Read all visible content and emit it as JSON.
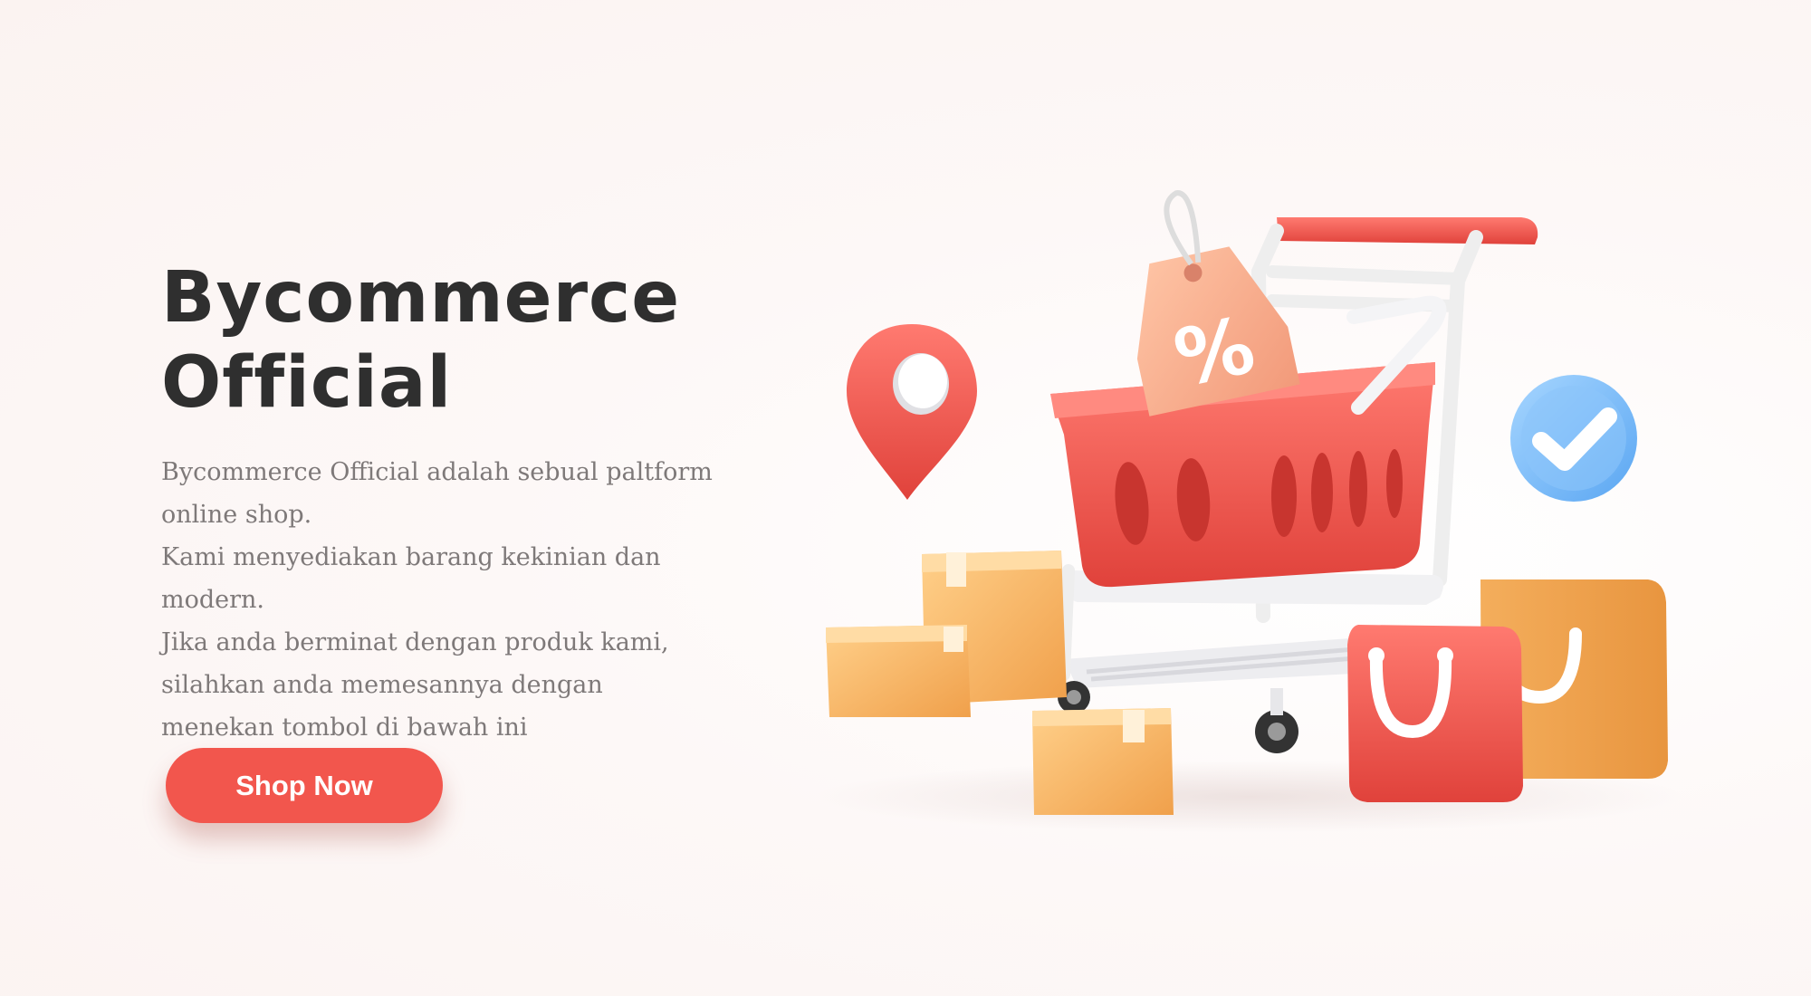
{
  "hero": {
    "title_line1": "Bycommerce",
    "title_line2": "Official",
    "description_lines": [
      "Bycommerce Official adalah sebual paltform",
      "online shop.",
      "Kami menyediakan barang kekinian dan",
      "modern.",
      "Jika anda berminat dengan produk kami,",
      "silahkan anda memesannya dengan",
      "menekan tombol di bawah ini"
    ],
    "cta_label": "Shop Now"
  },
  "illustration": {
    "tag_symbol": "%",
    "icons": [
      "location-pin-icon",
      "shopping-cart-icon",
      "discount-tag-icon",
      "check-badge-icon",
      "cardboard-box-icon",
      "shopping-bag-icon"
    ]
  },
  "colors": {
    "accent": "#f2564d",
    "title": "#2f2f2f",
    "body_text": "#7e7979",
    "background": "#fdf6f5",
    "box": "#f7b25f",
    "check_badge": "#74b7f7"
  }
}
